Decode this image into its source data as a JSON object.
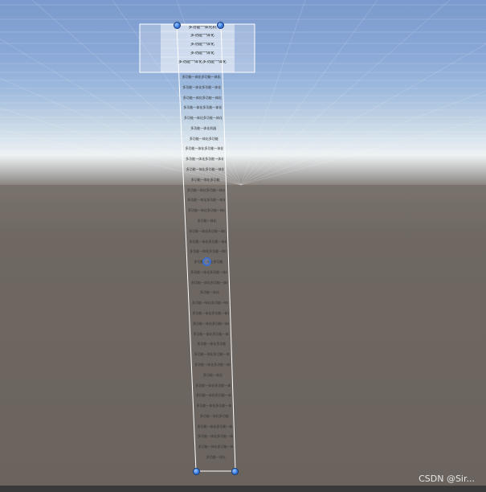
{
  "scene_view": {
    "header_lines": [
      "多功能一体化机",
      "多功能一体化",
      "多功能一体化",
      "多功能一体化",
      "多功能一体化多功能一体化机器"
    ],
    "body_lines": [
      "多功能一体化多功能一体化机器人",
      "多功能一体化多功能一体化机器人",
      "多功能一体化多功能一体化机器",
      "多功能一体化多功能一体化机器人",
      "多功能一体化多功能一体化机器",
      "多功能一体化机器",
      "多功能一体化多功能",
      "多功能一体化多功能一体化机器",
      "多功能一体化多功能一体化机器人",
      "多功能一体化多功能一体化机器",
      "多功能一体化多功能",
      "多功能一体化多功能一体化机器",
      "多功能一体化多功能一体化",
      "多功能一体化多功能一体化机器",
      "多功能一体化",
      "多功能一体化多功能一体化机器",
      "多功能一体化多功能一体化机器",
      "多功能一体化多功能一体化",
      "多功能一体化多功能",
      "多功能一体化多功能一体化机器",
      "多功能一体化多功能一体化机器",
      "多功能一体化",
      "多功能一体化多功能一体化",
      "多功能一体化多功能一体化机器",
      "多功能一体化多功能一体化",
      "多功能一体化多功能一体化机器",
      "多功能一体化多功能",
      "多功能一体化多功能一体化",
      "多功能一体化多功能一体化机器",
      "多功能一体化",
      "多功能一体化多功能一体化",
      "多功能一体化多功能一体化机器",
      "多功能一体化多功能一体化",
      "多功能一体化多功能",
      "多功能一体化多功能一体化机器",
      "多功能一体化多功能一体化",
      "多功能一体化多功能一体化机器",
      "多功能一体化"
    ],
    "colors": {
      "selection_outline": "#ffffff",
      "handle": "#3d7fe0",
      "grid_line": "#ffffff",
      "ground": "#6f6862"
    }
  },
  "watermark": "CSDN @Sir..."
}
